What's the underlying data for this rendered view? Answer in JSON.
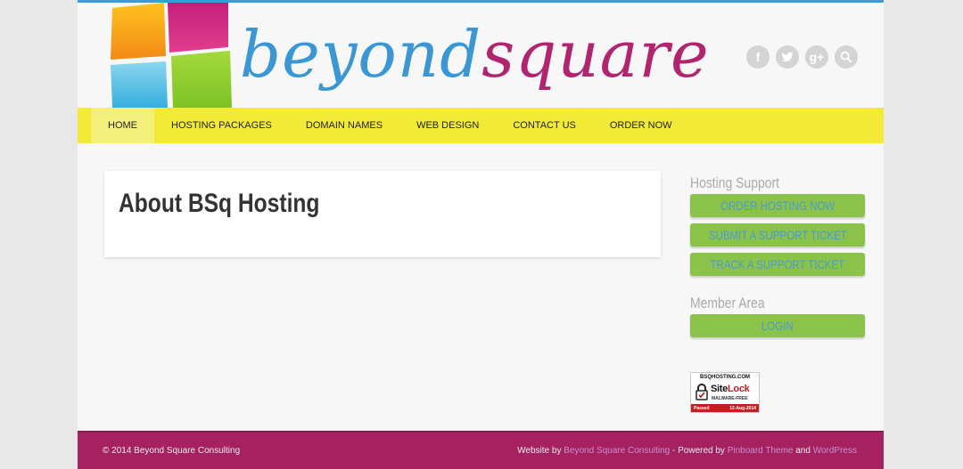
{
  "brand": {
    "logo_part1": "beyond",
    "logo_part2": "square",
    "colors": {
      "blue": "#3a97d4",
      "magenta": "#b0256e",
      "nav": "#f2ea37",
      "button": "#8bc34a",
      "footer": "#a5215f"
    }
  },
  "social": {
    "icons": [
      "facebook-icon",
      "twitter-icon",
      "google-plus-icon",
      "search-icon"
    ],
    "facebook_glyph": "f",
    "gplus_glyph": "g+"
  },
  "nav": {
    "items": [
      {
        "label": "HOME",
        "active": true
      },
      {
        "label": "HOSTING PACKAGES"
      },
      {
        "label": "DOMAIN NAMES"
      },
      {
        "label": "WEB DESIGN"
      },
      {
        "label": "CONTACT US"
      },
      {
        "label": "ORDER NOW"
      }
    ]
  },
  "main": {
    "title": "About BSq Hosting"
  },
  "sidebar": {
    "support_heading": "Hosting Support",
    "support_buttons": [
      "ORDER HOSTING NOW",
      "SUBMIT A SUPPORT TICKET",
      "TRACK A SUPPORT TICKET"
    ],
    "member_heading": "Member Area",
    "login_label": "LOGIN"
  },
  "sitelock": {
    "domain": "BSQHOSTING.COM",
    "name_site": "Site",
    "name_lock": "Lock",
    "status": "MALWARE-FREE",
    "passed": "Passed",
    "date": "12-Aug-2014"
  },
  "footer": {
    "copyright": "© 2014 Beyond Square Consulting",
    "credit_prefix": "Website by",
    "credit_author": "Beyond Square Consulting",
    "credit_mid": "- Powered by",
    "credit_theme": "Pinboard Theme",
    "credit_and": "and",
    "credit_platform": "WordPress"
  }
}
